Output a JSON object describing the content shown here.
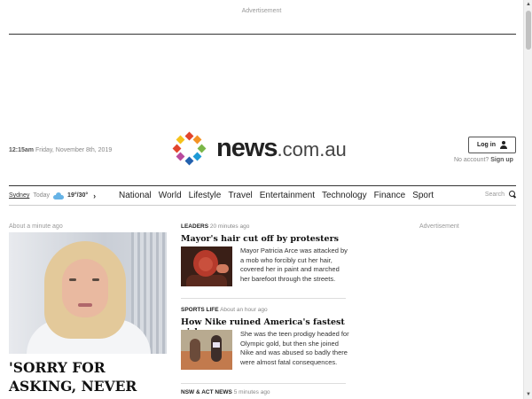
{
  "ads": {
    "top_label": "Advertisement",
    "sidebar_label": "Advertisement"
  },
  "masthead": {
    "time": "12:15am",
    "date": "Friday, November 8th, 2019",
    "logo_brand": "news",
    "logo_suffix": ".com.au",
    "logo_dot_colors": [
      "#e2452c",
      "#f39325",
      "#7ab648",
      "#1d9ad6",
      "#2361ae",
      "#b94a9e",
      "#e2452c",
      "#f5c21b"
    ],
    "login_label": "Log in",
    "no_account_text": "No account?",
    "signup_label": "Sign up"
  },
  "nav": {
    "weather": {
      "city": "Sydney",
      "day": "Today",
      "temps": "19°/30°",
      "icon": "cloud-icon"
    },
    "links": [
      "National",
      "World",
      "Lifestyle",
      "Travel",
      "Entertainment",
      "Technology",
      "Finance",
      "Sport"
    ],
    "search_label": "Search"
  },
  "lead": {
    "time": "About a minute ago",
    "headline": "'SORRY FOR ASKING, NEVER MIND': Today"
  },
  "stories": [
    {
      "section": "LEADERS",
      "time": "20 minutes ago",
      "title": "Mayor's hair cut off by protesters",
      "blurb": "Mayor Patricia Arce was attacked by a mob who forcibly cut her hair, covered her in paint and marched her barefoot through the streets."
    },
    {
      "section": "SPORTS LIFE",
      "time": "About an hour ago",
      "title": "How Nike ruined America's fastest girl",
      "blurb": "She was the teen prodigy headed for Olympic gold, but then she joined Nike and was abused so badly there were almost fatal consequences."
    },
    {
      "section": "NSW & ACT NEWS",
      "time": "5 minutes ago"
    }
  ]
}
